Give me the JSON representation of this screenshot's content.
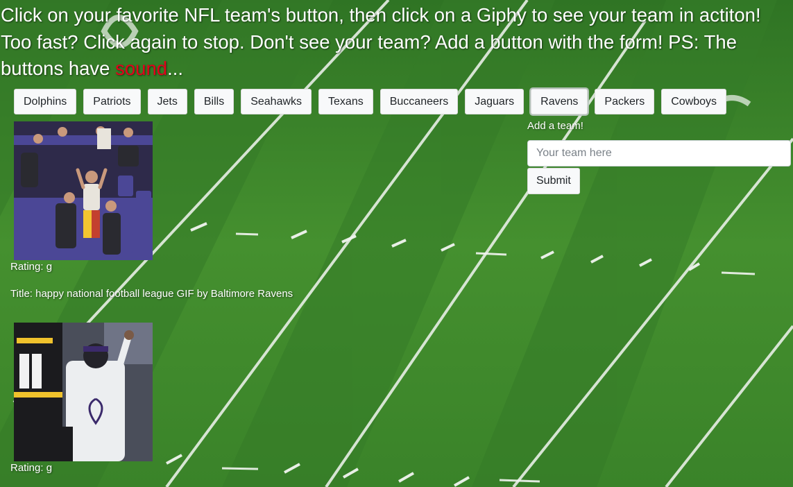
{
  "header": {
    "instructions": "Click on your favorite NFL team's button, then click on a Giphy to see your team in actiton! Too fast? Click again to stop. Don't see your team? Add a button with the form! PS: The buttons have ",
    "highlight_word": "sound",
    "trailing": "...",
    "highlight_color": "#e3001b"
  },
  "teams": [
    "Dolphins",
    "Patriots",
    "Jets",
    "Bills",
    "Seahawks",
    "Texans",
    "Buccaneers",
    "Jaguars",
    "Ravens",
    "Packers",
    "Cowboys"
  ],
  "selected_team": "Ravens",
  "form": {
    "label": "Add a team!",
    "placeholder": "Your team here",
    "submit_label": "Submit"
  },
  "gifs": [
    {
      "rating": "Rating: g",
      "title": "Title: happy national football league GIF by Baltimore Ravens"
    },
    {
      "rating": "Rating: g",
      "title": ""
    }
  ],
  "colors": {
    "field_green": "#3f8a2c",
    "button_bg": "#f8f9fa",
    "text_white": "#ffffff"
  }
}
